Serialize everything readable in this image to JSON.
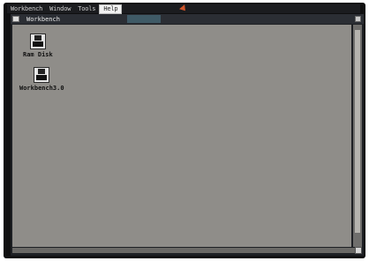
{
  "menubar": {
    "items": [
      "Workbench",
      "Window",
      "Tools",
      "Help"
    ]
  },
  "window": {
    "title": "Workbench"
  },
  "icons": [
    {
      "label": "Ram Disk",
      "icon": "disk-icon"
    },
    {
      "label": "Workbench3.0",
      "icon": "disk-icon"
    }
  ]
}
